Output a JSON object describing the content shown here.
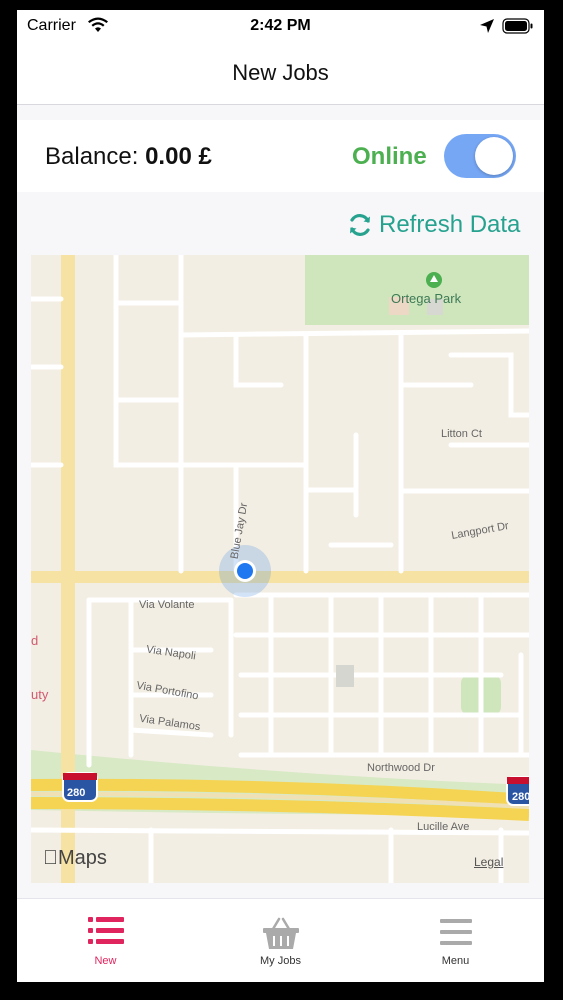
{
  "status_bar": {
    "carrier": "Carrier",
    "time": "2:42 PM"
  },
  "nav": {
    "title": "New Jobs"
  },
  "balance": {
    "label": "Balance:",
    "value": "0.00 £"
  },
  "online": {
    "label": "Online",
    "toggle_on": true,
    "color": "#4caf50",
    "toggle_color": "#76a7f5"
  },
  "refresh": {
    "label": "Refresh Data",
    "icon": "refresh-icon",
    "color": "#26a28f"
  },
  "map": {
    "labels": {
      "park": "Ortega Park",
      "litton": "Litton Ct",
      "langport": "Langport Dr",
      "bluejay": "Blue Jay Dr",
      "volante": "Via Volante",
      "napoli": "Via Napoli",
      "portofino": "Via Portofino",
      "palamos": "Via Palamos",
      "northwood": "Northwood Dr",
      "lucille": "Lucille Ave",
      "shield_left": "280",
      "shield_right": "280",
      "edge_a": "d",
      "edge_b": "uty"
    },
    "attribution": "Maps",
    "legal": "Legal"
  },
  "tabbar": {
    "tabs": [
      {
        "label": "New",
        "icon": "list-icon",
        "active": true
      },
      {
        "label": "My Jobs",
        "icon": "basket-icon",
        "active": false
      },
      {
        "label": "Menu",
        "icon": "menu-icon",
        "active": false
      }
    ],
    "active_color": "#e0245e",
    "inactive_color": "#333333"
  }
}
